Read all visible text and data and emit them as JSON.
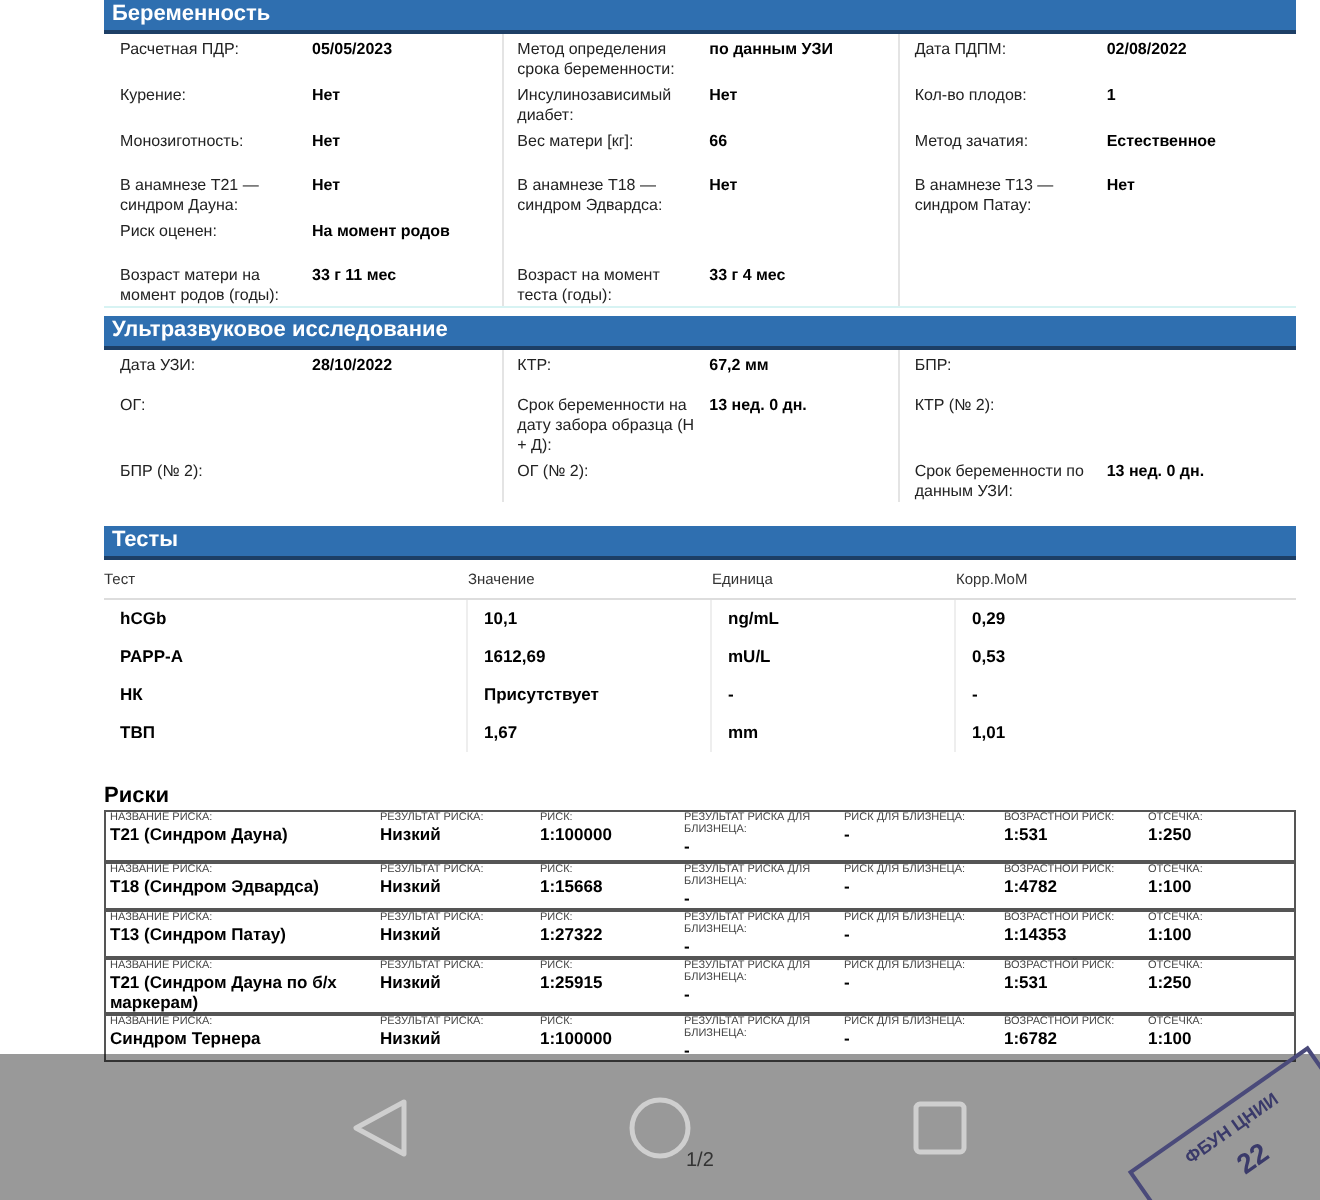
{
  "pregnancy": {
    "title": "Беременность",
    "rows": [
      [
        {
          "label": "Расчетная ПДР:",
          "value": "05/05/2023"
        },
        {
          "label": "Метод определения срока беременности:",
          "value": "по данным УЗИ"
        },
        {
          "label": "Дата ПДПМ:",
          "value": "02/08/2022"
        }
      ],
      [
        {
          "label": "Курение:",
          "value": "Нет"
        },
        {
          "label": "Инсулинозависимый диабет:",
          "value": "Нет"
        },
        {
          "label": "Кол-во плодов:",
          "value": "1"
        }
      ],
      [
        {
          "label": "Монозиготность:",
          "value": "Нет"
        },
        {
          "label": "Вес матери [кг]:",
          "value": "66"
        },
        {
          "label": "Метод зачатия:",
          "value": "Естественное"
        }
      ],
      [
        {
          "label": "В анамнезе Т21 — синдром Дауна:",
          "value": "Нет"
        },
        {
          "label": "В анамнезе Т18 — синдром Эдвардса:",
          "value": "Нет"
        },
        {
          "label": "В анамнезе Т13 — синдром Патау:",
          "value": "Нет"
        }
      ],
      [
        {
          "label": "Риск оценен:",
          "value": "На момент родов"
        }
      ],
      [
        {
          "label": "Возраст матери на момент родов (годы):",
          "value": "33 г 11 мес"
        },
        {
          "label": "Возраст на момент теста (годы):",
          "value": "33 г 4 мес"
        }
      ]
    ]
  },
  "ultrasound": {
    "title": "Ультразвуковое исследование",
    "rows": [
      [
        {
          "label": "Дата УЗИ:",
          "value": "28/10/2022"
        },
        {
          "label": "КТР:",
          "value": "67,2 мм"
        },
        {
          "label": "БПР:"
        }
      ],
      [
        {
          "label": "ОГ:"
        },
        {
          "label": "Срок беременности на дату забора образца (Н + Д):",
          "value": "13 нед. 0 дн."
        },
        {
          "label": "КТР (№ 2):"
        }
      ],
      [
        {
          "label": "БПР (№ 2):"
        },
        {
          "label": "ОГ (№ 2):"
        },
        {
          "label": "Срок беременности по данным УЗИ:",
          "value": "13 нед. 0 дн."
        }
      ]
    ]
  },
  "tests": {
    "title": "Тесты",
    "columns": [
      "Тест",
      "Значение",
      "Единица",
      "Корр.МоМ"
    ],
    "rows": [
      [
        "hCGb",
        "10,1",
        "ng/mL",
        "0,29"
      ],
      [
        "PAPP-A",
        "1612,69",
        "mU/L",
        "0,53"
      ],
      [
        "НК",
        "Присутствует",
        "-",
        "-"
      ],
      [
        "ТВП",
        "1,67",
        "mm",
        "1,01"
      ]
    ]
  },
  "risks": {
    "title": "Риски",
    "rows": [
      [
        {
          "label": "НАЗВАНИЕ РИСКА:",
          "value": "Т21 (Синдром Дауна)"
        },
        {
          "label": "РЕЗУЛЬТАТ РИСКА:",
          "value": "Низкий"
        },
        {
          "label": "РИСК:",
          "value": "1:100000"
        },
        {
          "label": "РЕЗУЛЬТАТ РИСКА ДЛЯ БЛИЗНЕЦА:",
          "value": "-"
        },
        {
          "label": "РИСК ДЛЯ БЛИЗНЕЦА:",
          "value": "-"
        },
        {
          "label": "ВОЗРАСТНОЙ РИСК:",
          "value": "1:531"
        },
        {
          "label": "ОТСЕЧКА:",
          "value": "1:250"
        }
      ],
      [
        {
          "label": "НАЗВАНИЕ РИСКА:",
          "value": "Т18 (Синдром Эдвардса)"
        },
        {
          "label": "РЕЗУЛЬТАТ РИСКА:",
          "value": "Низкий"
        },
        {
          "label": "РИСК:",
          "value": "1:15668"
        },
        {
          "label": "РЕЗУЛЬТАТ РИСКА ДЛЯ БЛИЗНЕЦА:",
          "value": "-"
        },
        {
          "label": "РИСК ДЛЯ БЛИЗНЕЦА:",
          "value": "-"
        },
        {
          "label": "ВОЗРАСТНОЙ РИСК:",
          "value": "1:4782"
        },
        {
          "label": "ОТСЕЧКА:",
          "value": "1:100"
        }
      ],
      [
        {
          "label": "НАЗВАНИЕ РИСКА:",
          "value": "Т13 (Синдром Патау)"
        },
        {
          "label": "РЕЗУЛЬТАТ РИСКА:",
          "value": "Низкий"
        },
        {
          "label": "РИСК:",
          "value": "1:27322"
        },
        {
          "label": "РЕЗУЛЬТАТ РИСКА ДЛЯ БЛИЗНЕЦА:",
          "value": "-"
        },
        {
          "label": "РИСК ДЛЯ БЛИЗНЕЦА:",
          "value": "-"
        },
        {
          "label": "ВОЗРАСТНОЙ РИСК:",
          "value": "1:14353"
        },
        {
          "label": "ОТСЕЧКА:",
          "value": "1:100"
        }
      ],
      [
        {
          "label": "НАЗВАНИЕ РИСКА:",
          "value": "Т21 (Синдром Дауна по б/х маркерам)"
        },
        {
          "label": "РЕЗУЛЬТАТ РИСКА:",
          "value": "Низкий"
        },
        {
          "label": "РИСК:",
          "value": "1:25915"
        },
        {
          "label": "РЕЗУЛЬТАТ РИСКА ДЛЯ БЛИЗНЕЦА:",
          "value": "-"
        },
        {
          "label": "РИСК ДЛЯ БЛИЗНЕЦА:",
          "value": "-"
        },
        {
          "label": "ВОЗРАСТНОЙ РИСК:",
          "value": "1:531"
        },
        {
          "label": "ОТСЕЧКА:",
          "value": "1:250"
        }
      ],
      [
        {
          "label": "НАЗВАНИЕ РИСКА:",
          "value": "Синдром Тернера"
        },
        {
          "label": "РЕЗУЛЬТАТ РИСКА:",
          "value": "Низкий"
        },
        {
          "label": "РИСК:",
          "value": "1:100000"
        },
        {
          "label": "РЕЗУЛЬТАТ РИСКА ДЛЯ БЛИЗНЕЦА:",
          "value": "-"
        },
        {
          "label": "РИСК ДЛЯ БЛИЗНЕЦА:",
          "value": "-"
        },
        {
          "label": "ВОЗРАСТНОЙ РИСК:",
          "value": "1:6782"
        },
        {
          "label": "ОТСЕЧКА:",
          "value": "1:100"
        }
      ]
    ]
  },
  "page_indicator": "1/2",
  "stamp": {
    "text": "ФБУН ЦНИИ",
    "number": "22"
  }
}
